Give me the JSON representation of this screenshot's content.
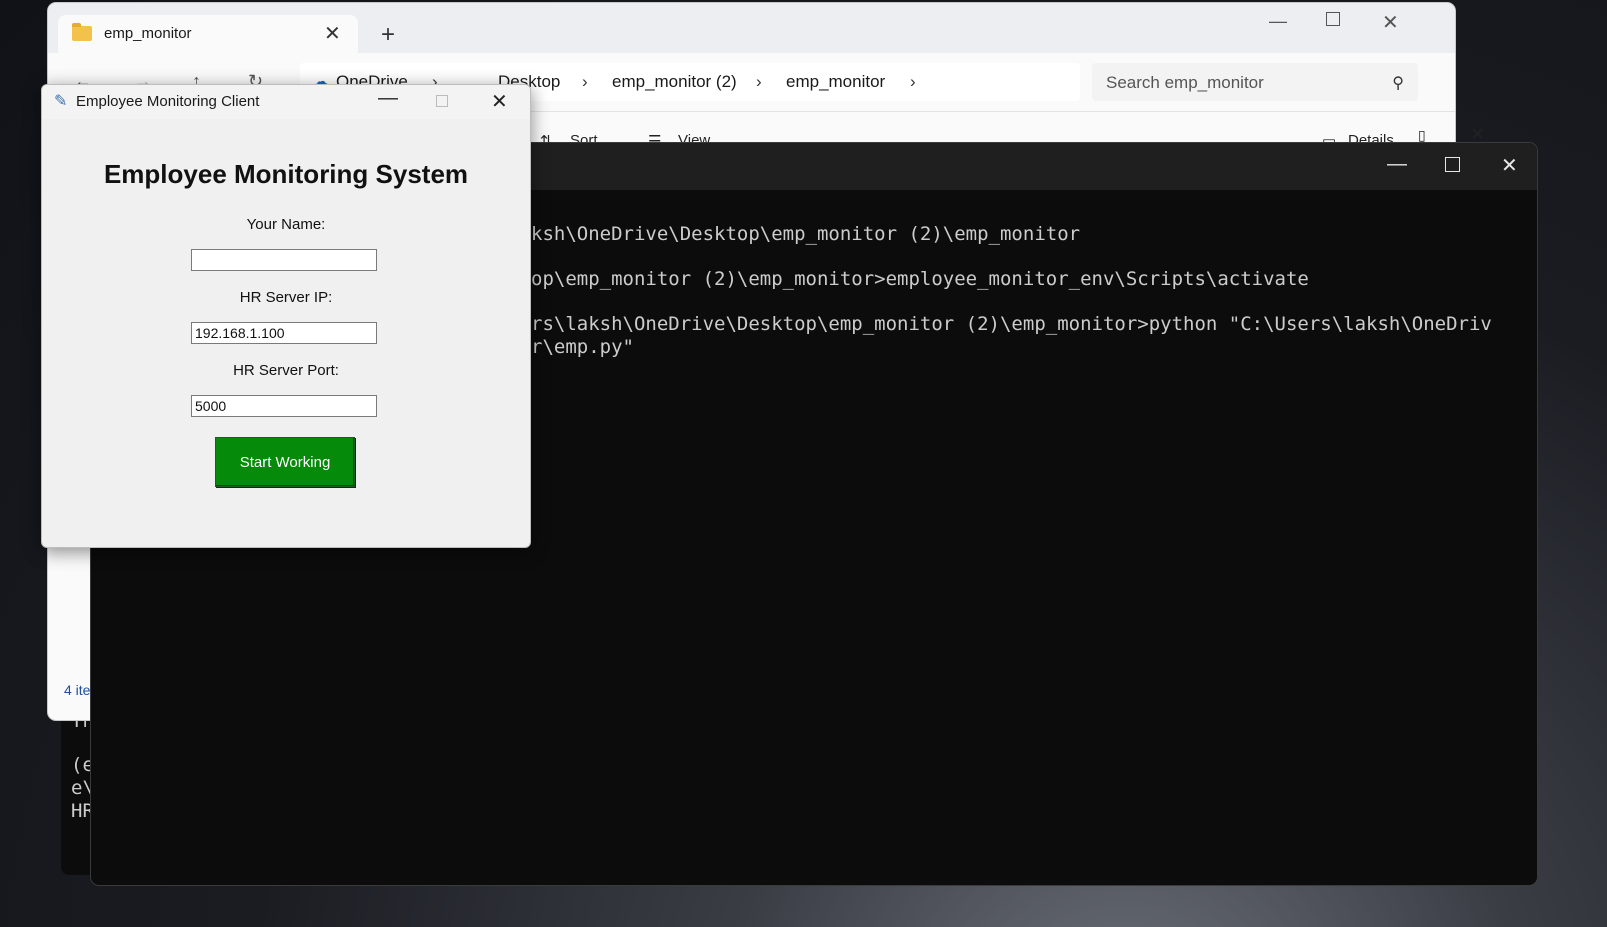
{
  "explorer": {
    "tab_title": "emp_monitor",
    "new_tab": "+",
    "breadcrumbs": [
      "OneDrive",
      "...",
      "Desktop",
      "emp_monitor (2)",
      "emp_monitor"
    ],
    "search_placeholder": "Search emp_monitor",
    "commands": {
      "sort": "Sort",
      "view": "View",
      "more": "...",
      "details": "Details"
    },
    "status": "4 ite"
  },
  "back_terminal": {
    "lines": [
      "Th",
      "(e",
      "e\\",
      "HR"
    ]
  },
  "terminal": {
    "lines": [
      "ksh\\OneDrive\\Desktop\\emp_monitor (2)\\emp_monitor",
      "op\\emp_monitor (2)\\emp_monitor>employee_monitor_env\\Scripts\\activate",
      "rs\\laksh\\OneDrive\\Desktop\\emp_monitor (2)\\emp_monitor>python \"C:\\Users\\laksh\\OneDriv",
      "r\\emp.py\""
    ]
  },
  "client": {
    "window_title": "Employee Monitoring Client",
    "heading": "Employee Monitoring System",
    "name_label": "Your Name:",
    "name_value": "",
    "ip_label": "HR Server IP:",
    "ip_value": "192.168.1.100",
    "port_label": "HR Server Port:",
    "port_value": "5000",
    "start_button": "Start Working"
  }
}
